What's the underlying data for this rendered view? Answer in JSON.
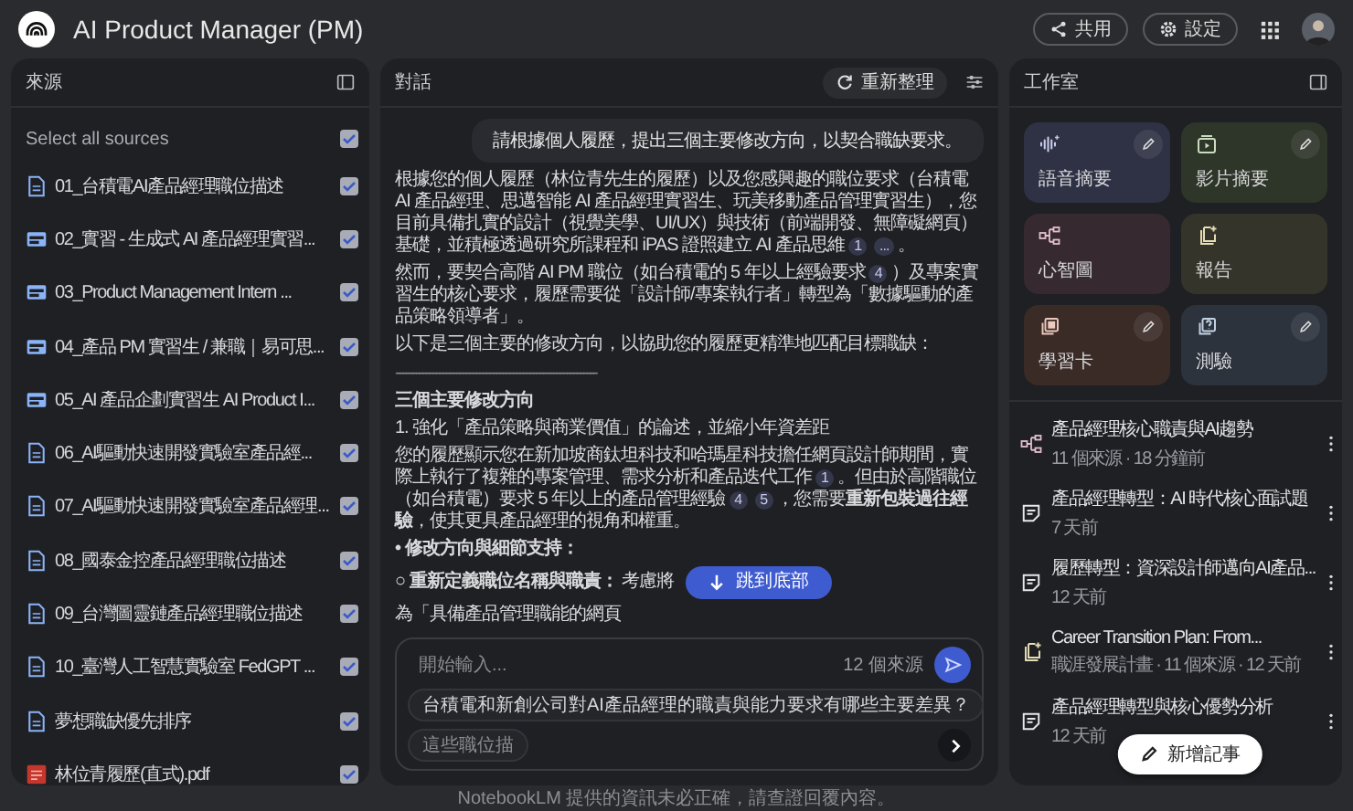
{
  "app": {
    "title": "AI Product Manager (PM)",
    "actions": [
      {
        "kind": "share",
        "label": "共用"
      },
      {
        "kind": "settings",
        "label": "設定"
      }
    ]
  },
  "sources": {
    "title": "來源",
    "select_all": {
      "label": "Select all sources",
      "checked": true
    },
    "items": [
      {
        "kind": "doc",
        "name": "01_台積電AI產品經理職位描述",
        "checked": true
      },
      {
        "kind": "web",
        "name": "02_實習 - 生成式 AI 產品經理實習...",
        "checked": true
      },
      {
        "kind": "web",
        "name": "03_Product Management Intern ...",
        "checked": true
      },
      {
        "kind": "web",
        "name": "04_產品 PM 實習生 / 兼職｜易可思...",
        "checked": true
      },
      {
        "kind": "web",
        "name": "05_AI 產品企劃實習生 AI Product I...",
        "checked": true
      },
      {
        "kind": "doc",
        "name": "06_AI驅動快速開發實驗室產品經...",
        "checked": true
      },
      {
        "kind": "doc",
        "name": "07_AI驅動快速開發實驗室產品經理...",
        "checked": true
      },
      {
        "kind": "doc",
        "name": "08_國泰金控產品經理職位描述",
        "checked": true
      },
      {
        "kind": "doc",
        "name": "09_台灣圖靈鏈產品經理職位描述",
        "checked": true
      },
      {
        "kind": "doc",
        "name": "10_臺灣人工智慧實驗室 FedGPT ...",
        "checked": true
      },
      {
        "kind": "doc",
        "name": "夢想職缺優先排序",
        "checked": true
      },
      {
        "kind": "pdf",
        "name": "林位青履歷(直式).pdf",
        "checked": true
      }
    ]
  },
  "chat": {
    "title": "對話",
    "refresh_label": "重新整理",
    "user_message": "請根據個人履歷，提出三個主要修改方向，以契合職缺要求。",
    "blocks": [
      {
        "kind": "para",
        "parts": [
          {
            "kind": "text",
            "text": "根據您的個人履歷（林位青先生的履歷）以及您感興趣的職位要求（台積電 AI 產品經理、思邁智能 AI 產品經理實習生、玩美移動產品管理實習生），您目前具備扎實的設計（視覺美學、UI/UX）與技術（前端開發、無障礙網頁）基礎，並積極透過研究所課程和 iPAS 證照建立 AI 產品思維"
          },
          {
            "kind": "cite",
            "text": "1"
          },
          {
            "kind": "cite",
            "text": "..."
          },
          {
            "kind": "text",
            "text": "。"
          }
        ]
      },
      {
        "kind": "para",
        "parts": [
          {
            "kind": "text",
            "text": "然而，要契合高階 AI PM 職位（如台積電的 5 年以上經驗要求"
          },
          {
            "kind": "cite",
            "text": "4"
          },
          {
            "kind": "text",
            "text": "）及專案實習生的核心要求，履歷需要從「設計師/專案執行者」轉型為「數據驅動的產品策略領導者」。"
          }
        ]
      },
      {
        "kind": "para",
        "parts": [
          {
            "kind": "text",
            "text": "以下是三個主要的修改方向，以協助您的履歷更精準地匹配目標職缺："
          }
        ]
      },
      {
        "kind": "rule",
        "parts": [
          {
            "kind": "text",
            "text": "------------------------------------------------------------"
          }
        ]
      },
      {
        "kind": "heading",
        "parts": [
          {
            "kind": "text",
            "text": "三個主要修改方向"
          }
        ]
      },
      {
        "kind": "para",
        "parts": [
          {
            "kind": "text",
            "text": "1. 強化「產品策略與商業價值」的論述，並縮小年資差距"
          }
        ]
      },
      {
        "kind": "para",
        "parts": [
          {
            "kind": "text",
            "text": "您的履歷顯示您在新加坡商鈦坦科技和哈瑪星科技擔任網頁設計師期間，實際上執行了複雜的專案管理、需求分析和產品迭代工作"
          },
          {
            "kind": "cite",
            "text": "1"
          },
          {
            "kind": "text",
            "text": "。但由於高階職位（如台積電）要求 5 年以上的產品管理經驗"
          },
          {
            "kind": "cite",
            "text": "4"
          },
          {
            "kind": "cite",
            "text": "5"
          },
          {
            "kind": "text",
            "text": "，您需要**重新包裝過往經驗**，使其更具產品經理的視角和權重。"
          }
        ]
      },
      {
        "kind": "heading",
        "parts": [
          {
            "kind": "text",
            "text": "• 修改方向與細節支持："
          }
        ]
      },
      {
        "kind": "split",
        "parts": [
          {
            "kind": "text",
            "text": "○ **重新定義職位名稱與職責：** 考慮將"
          },
          {
            "kind": "text",
            "text": "為「具備產品管理職能的網頁"
          }
        ]
      }
    ],
    "jump_label": "跳到底部",
    "input": {
      "placeholder": "開始輸入...",
      "source_count": "12 個來源"
    },
    "suggestions": [
      "台積電和新創公司對AI產品經理的職責與能力要求有哪些主要差異？",
      "這些職位描"
    ]
  },
  "studio": {
    "title": "工作室",
    "tiles": [
      {
        "kind": "audio",
        "label": "語音摘要",
        "color": "#2f3245",
        "editable": true
      },
      {
        "kind": "video",
        "label": "影片摘要",
        "color": "#2e3529",
        "editable": true
      },
      {
        "kind": "mindmap",
        "label": "心智圖",
        "color": "#36292f",
        "editable": false
      },
      {
        "kind": "report",
        "label": "報告",
        "color": "#35342a",
        "editable": false
      },
      {
        "kind": "flashcard",
        "label": "學習卡",
        "color": "#3a2b27",
        "editable": true
      },
      {
        "kind": "quiz",
        "label": "測驗",
        "color": "#2c333d",
        "editable": true
      }
    ],
    "notes": [
      {
        "kind": "mindmap",
        "title": "產品經理核心職責與AI趨勢",
        "meta": "11 個來源 · 18 分鐘前"
      },
      {
        "kind": "note",
        "title": "產品經理轉型：AI 時代核心面試題",
        "meta": "7 天前"
      },
      {
        "kind": "note",
        "title": "履歷轉型：資深設計師邁向AI產品...",
        "meta": "12 天前"
      },
      {
        "kind": "report",
        "title": "Career Transition Plan: From...",
        "meta": "職涯發展計畫 · 11 個來源 · 12 天前"
      },
      {
        "kind": "note",
        "title": "產品經理轉型與核心優勢分析",
        "meta": "12 天前"
      }
    ],
    "add_note_label": "新增記事"
  },
  "footer": "NotebookLM 提供的資訊未必正確，請查證回覆內容。"
}
